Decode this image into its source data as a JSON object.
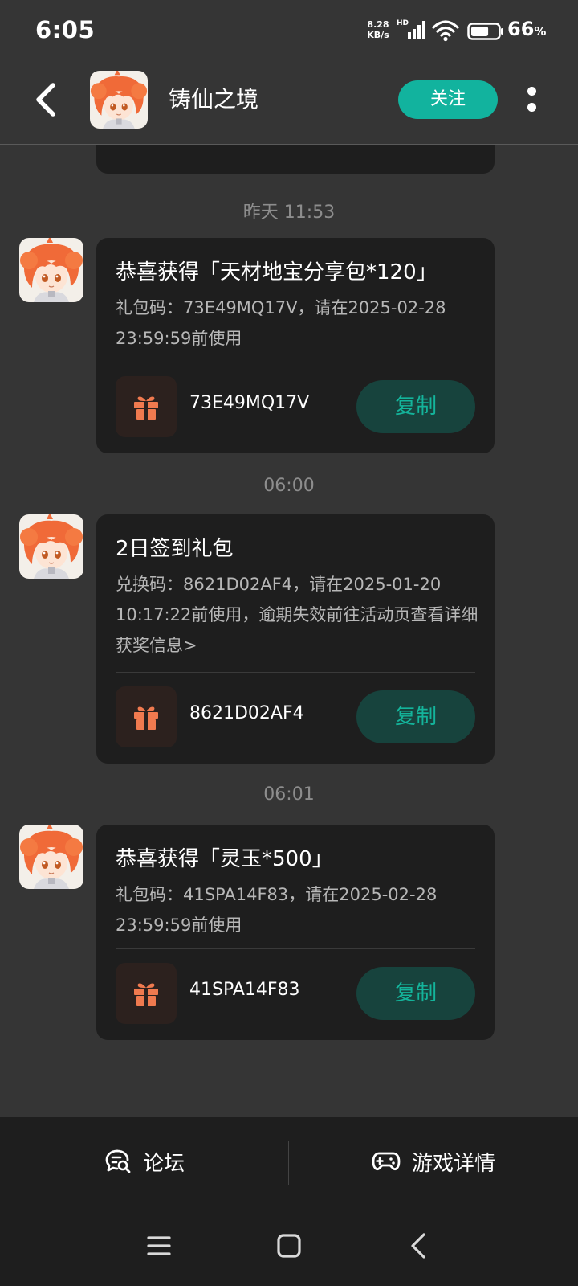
{
  "status_bar": {
    "time": "6:05",
    "net_speed_value": "8.28",
    "net_speed_unit": "KB/s",
    "hd_label": "HD",
    "battery_level": 66,
    "battery_percent_number": "66",
    "battery_percent_symbol": "%"
  },
  "header": {
    "title": "铸仙之境",
    "follow_label": "关注"
  },
  "messages": [
    {
      "timestamp": "昨天 11:53",
      "title": "恭喜获得「天材地宝分享包*120」",
      "body": "礼包码：73E49MQ17V，请在2025-02-28 23:59:59前使用",
      "code": "73E49MQ17V",
      "copy_label": "复制"
    },
    {
      "timestamp": "06:00",
      "title": "2日签到礼包",
      "body": "兑换码：8621D02AF4，请在2025-01-20 10:17:22前使用，逾期失效前往活动页查看详细获奖信息>",
      "code": "8621D02AF4",
      "copy_label": "复制"
    },
    {
      "timestamp": "06:01",
      "title": "恭喜获得「灵玉*500」",
      "body": "礼包码：41SPA14F83，请在2025-02-28 23:59:59前使用",
      "code": "41SPA14F83",
      "copy_label": "复制"
    }
  ],
  "bottom_bar": {
    "forum_label": "论坛",
    "game_detail_label": "游戏详情"
  },
  "colors": {
    "accent": "#12b39e",
    "copy_text": "#14b49b",
    "gift": "#f07a4f",
    "card_bg": "#1e1e1e",
    "page_bg": "#353535"
  }
}
